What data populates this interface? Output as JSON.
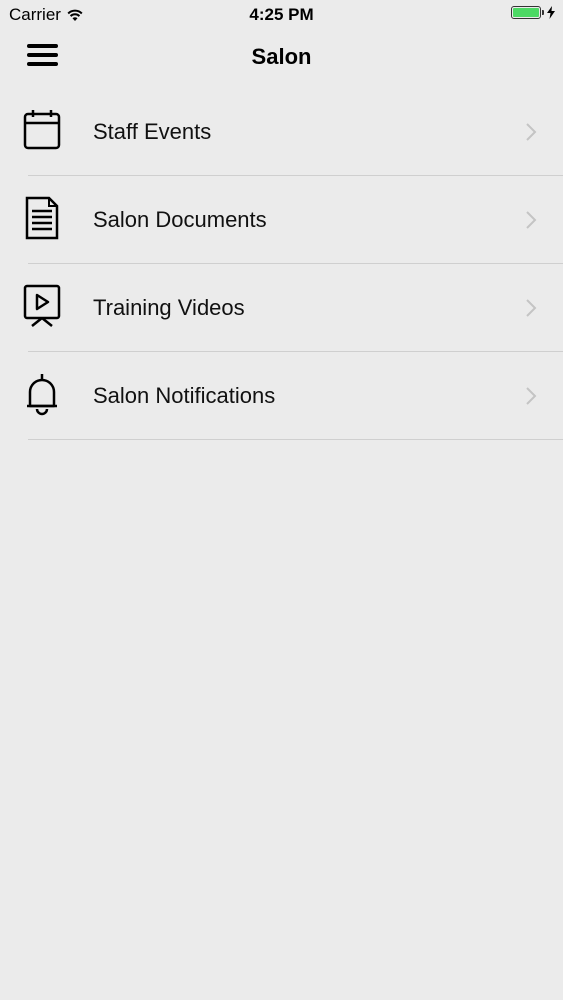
{
  "status_bar": {
    "carrier": "Carrier",
    "time": "4:25 PM",
    "battery_color": "#4cd964"
  },
  "nav": {
    "title": "Salon",
    "menu_icon": "hamburger-menu-icon"
  },
  "menu": {
    "items": [
      {
        "label": "Staff Events",
        "icon": "calendar-icon"
      },
      {
        "label": "Salon Documents",
        "icon": "document-icon"
      },
      {
        "label": "Training Videos",
        "icon": "video-presentation-icon"
      },
      {
        "label": "Salon Notifications",
        "icon": "bell-icon"
      }
    ]
  }
}
